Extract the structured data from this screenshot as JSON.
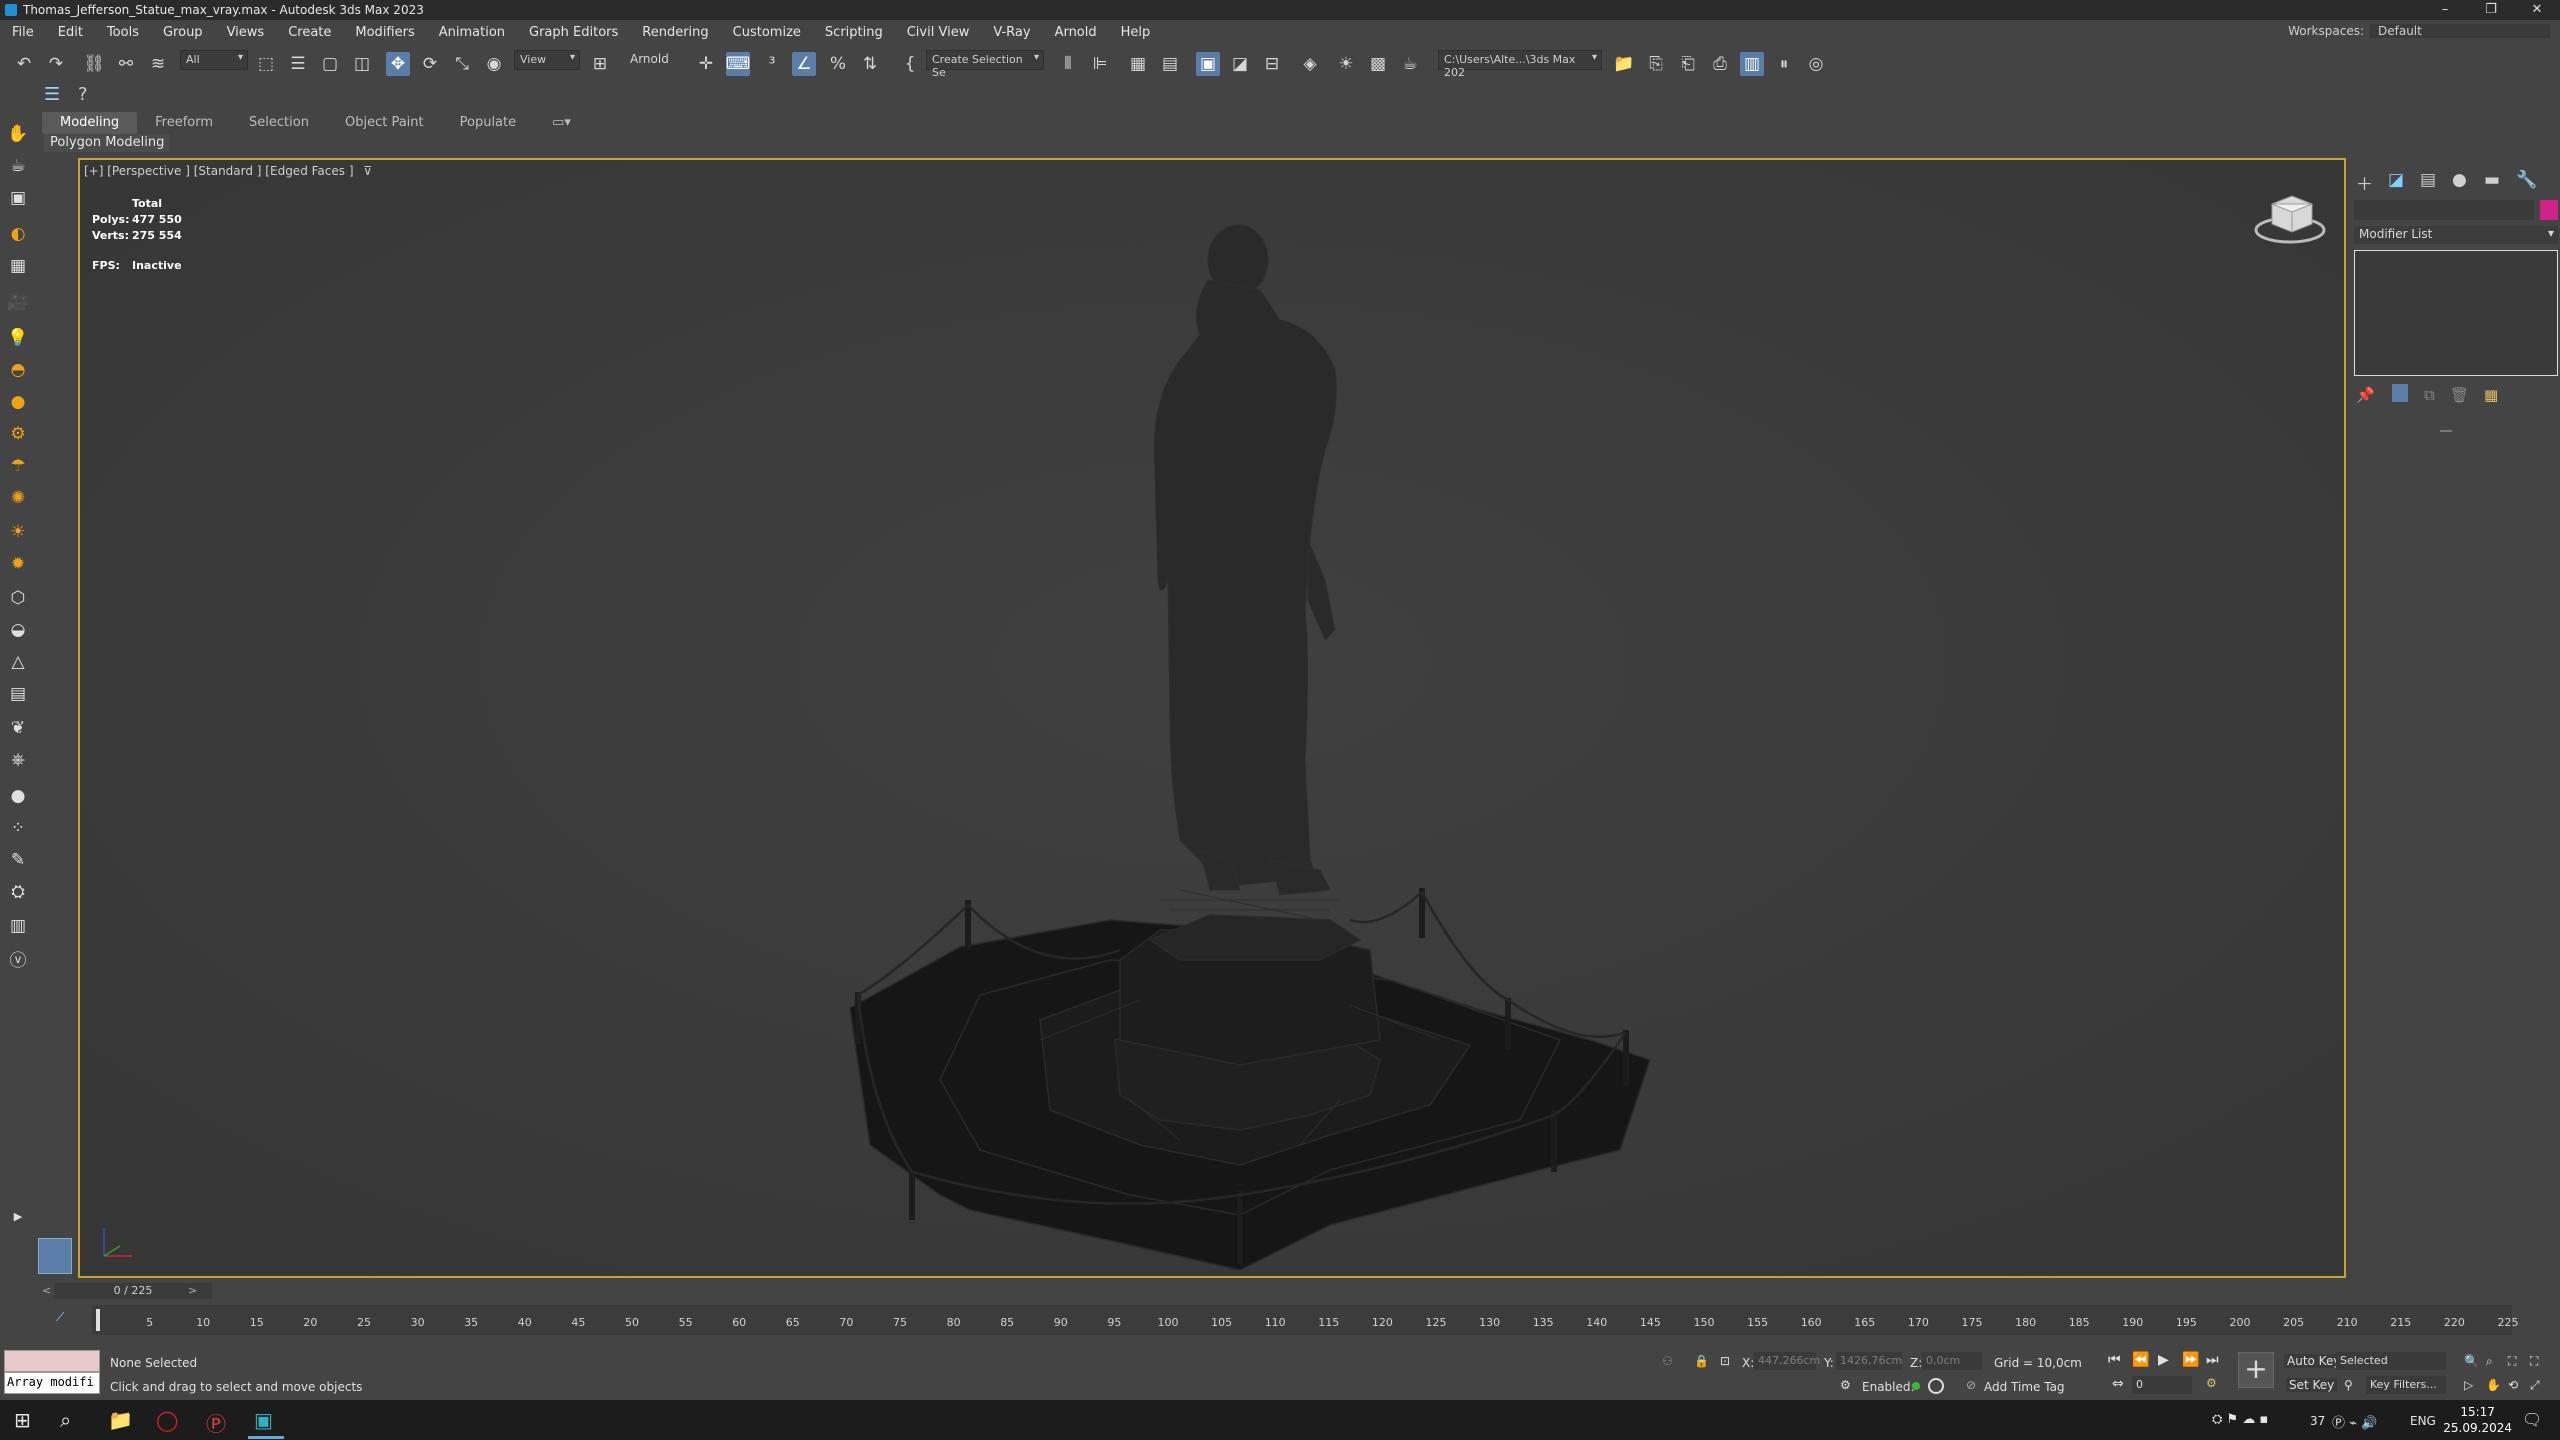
{
  "window": {
    "title": "Thomas_Jefferson_Statue_max_vray.max - Autodesk 3ds Max 2023",
    "controls": [
      "–",
      "❐",
      "✕"
    ]
  },
  "menu": [
    "File",
    "Edit",
    "Tools",
    "Group",
    "Views",
    "Create",
    "Modifiers",
    "Animation",
    "Graph Editors",
    "Rendering",
    "Customize",
    "Scripting",
    "Civil View",
    "V-Ray",
    "Arnold",
    "Help"
  ],
  "workspace": {
    "label": "Workspaces:",
    "value": "Default"
  },
  "toolbar": {
    "selection_filter": "All",
    "ref_coord": "View",
    "arnold_label": "Arnold",
    "named_selection": "Create Selection Se",
    "project_path": "C:\\Users\\Alte...\\3ds Max 202"
  },
  "ribbon": {
    "tabs": [
      "Modeling",
      "Freeform",
      "Selection",
      "Object Paint",
      "Populate"
    ],
    "active_tab": "Modeling",
    "sub": "Polygon Modeling"
  },
  "viewport": {
    "label": "[+] [Perspective ] [Standard ] [Edged Faces ]",
    "stats_header": "Total",
    "polys_label": "Polys:",
    "polys_value": "477 550",
    "verts_label": "Verts:",
    "verts_value": "275 554",
    "fps_label": "FPS:",
    "fps_value": "Inactive"
  },
  "command_panel": {
    "modifier_list": "Modifier List",
    "object_color": "#d0228a"
  },
  "timeline": {
    "slider": "0 / 225",
    "ticks": [
      "5",
      "10",
      "15",
      "20",
      "25",
      "30",
      "35",
      "40",
      "45",
      "50",
      "55",
      "60",
      "65",
      "70",
      "75",
      "80",
      "85",
      "90",
      "95",
      "100",
      "105",
      "110",
      "115",
      "120",
      "125",
      "130",
      "135",
      "140",
      "145",
      "150",
      "155",
      "160",
      "165",
      "170",
      "175",
      "180",
      "185",
      "190",
      "195",
      "200",
      "205",
      "210",
      "215",
      "220",
      "225"
    ]
  },
  "status": {
    "maxscript": "Array modifi",
    "selection": "None Selected",
    "prompt": "Click and drag to select and move objects",
    "x_label": "X:",
    "x_value": "447,266cm",
    "y_label": "Y:",
    "y_value": "1426,76cm",
    "z_label": "Z:",
    "z_value": "0,0cm",
    "grid": "Grid = 10,0cm",
    "enabled": "Enabled:",
    "add_time_tag": "Add Time Tag",
    "auto_key": "Auto Key",
    "set_key": "Set Key",
    "selected": "Selected",
    "key_filters": "Key Filters...",
    "frame": "0"
  },
  "taskbar": {
    "tray_temp": "37",
    "lang": "ENG",
    "time": "15:17",
    "date": "25.09.2024"
  }
}
